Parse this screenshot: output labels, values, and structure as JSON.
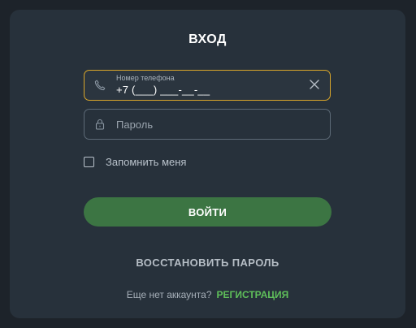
{
  "form": {
    "title": "ВХОД",
    "phone": {
      "label": "Номер телефона",
      "value": "+7 (___) ___-__-__",
      "icon": "phone-icon",
      "clear_icon": "close-icon"
    },
    "password": {
      "placeholder": "Пароль",
      "icon": "lock-icon"
    },
    "remember_label": "Запомнить меня",
    "login_label": "ВОЙТИ",
    "restore_label": "ВОССТАНОВИТЬ ПАРОЛЬ",
    "no_account_text": "Еще нет аккаунта?",
    "register_label": "РЕГИСТРАЦИЯ"
  },
  "colors": {
    "background": "#1d232a",
    "panel": "#27313b",
    "active_border": "#d9a62a",
    "button": "#3c7543",
    "link": "#5fbf5a"
  }
}
